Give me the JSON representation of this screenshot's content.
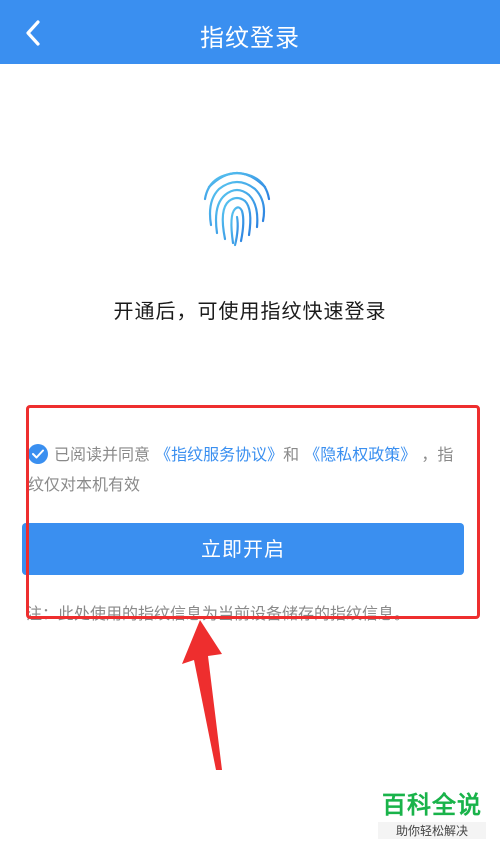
{
  "header": {
    "title": "指纹登录",
    "back_icon": "back-chevron-icon"
  },
  "main": {
    "fingerprint_icon": "fingerprint-icon",
    "subtitle": "开通后，可使用指纹快速登录",
    "agreement": {
      "checked": true,
      "prefix": "已阅读并同意",
      "link1": "《指纹服务协议》",
      "and": "和",
      "link2": "《隐私权政策》",
      "suffix": "，指纹仅对本机有效"
    },
    "enable_button": "立即开启",
    "note": "注：此处使用的指纹信息为当前设备储存的指纹信息。"
  },
  "watermark": {
    "title": "百科全说",
    "subtitle": "助你轻松解决"
  },
  "colors": {
    "brand": "#3a8ff0",
    "highlight": "#ee2e2e",
    "watermark": "#19b34a"
  }
}
